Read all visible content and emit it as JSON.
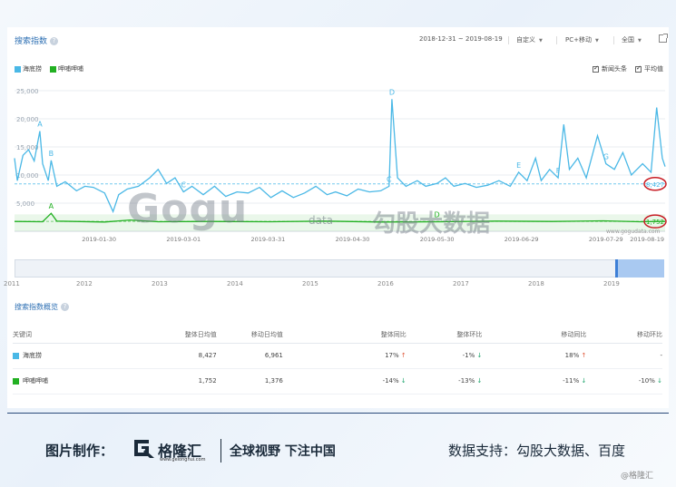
{
  "header": {
    "title": "搜索指数",
    "date_range": "2018-12-31 ~ 2019-08-19",
    "custom": "自定义",
    "device": "PC+移动",
    "region": "全国"
  },
  "legend": {
    "series1": "海底捞",
    "series2": "呷哺呷哺",
    "opt1": "新闻头条",
    "opt2": "平均值"
  },
  "colors": {
    "series1": "#4ab8e6",
    "series2": "#22b022",
    "avg1": "#74c9ee",
    "avg2": "#c2e8c2",
    "highlight": "#c81d25"
  },
  "chart_data": {
    "type": "line",
    "ylim": [
      0,
      25000
    ],
    "yticks": [
      "5,000",
      "10,000",
      "15,000",
      "20,000",
      "25,000"
    ],
    "xticks": [
      "2019-01-30",
      "2019-03-01",
      "2019-03-31",
      "2019-04-30",
      "2019-05-30",
      "2019-06-29",
      "2019-07-29",
      "2019-08-19"
    ],
    "x_start": "2018-12-31",
    "x_end": "2019-08-19",
    "series": [
      {
        "name": "海底捞",
        "points": [
          [
            "2018-12-31",
            13000
          ],
          [
            "2019-01-01",
            9000
          ],
          [
            "2019-01-03",
            13500
          ],
          [
            "2019-01-05",
            14500
          ],
          [
            "2019-01-07",
            12500
          ],
          [
            "2019-01-09",
            17800
          ],
          [
            "2019-01-10",
            12000
          ],
          [
            "2019-01-12",
            9000
          ],
          [
            "2019-01-13",
            12600
          ],
          [
            "2019-01-15",
            8000
          ],
          [
            "2019-01-18",
            8800
          ],
          [
            "2019-01-22",
            7200
          ],
          [
            "2019-01-25",
            8000
          ],
          [
            "2019-01-28",
            7800
          ],
          [
            "2019-02-01",
            6800
          ],
          [
            "2019-02-04",
            3500
          ],
          [
            "2019-02-06",
            6500
          ],
          [
            "2019-02-09",
            7500
          ],
          [
            "2019-02-13",
            8000
          ],
          [
            "2019-02-17",
            9500
          ],
          [
            "2019-02-20",
            11000
          ],
          [
            "2019-02-23",
            8500
          ],
          [
            "2019-02-26",
            9500
          ],
          [
            "2019-03-01",
            7000
          ],
          [
            "2019-03-04",
            8000
          ],
          [
            "2019-03-08",
            6500
          ],
          [
            "2019-03-12",
            8000
          ],
          [
            "2019-03-16",
            6200
          ],
          [
            "2019-03-20",
            7000
          ],
          [
            "2019-03-24",
            6800
          ],
          [
            "2019-03-28",
            7800
          ],
          [
            "2019-04-01",
            6000
          ],
          [
            "2019-04-05",
            7200
          ],
          [
            "2019-04-09",
            6000
          ],
          [
            "2019-04-13",
            6800
          ],
          [
            "2019-04-17",
            8000
          ],
          [
            "2019-04-21",
            6500
          ],
          [
            "2019-04-24",
            7000
          ],
          [
            "2019-04-28",
            6300
          ],
          [
            "2019-05-02",
            7500
          ],
          [
            "2019-05-06",
            7000
          ],
          [
            "2019-05-10",
            7200
          ],
          [
            "2019-05-13",
            8000
          ],
          [
            "2019-05-14",
            23500
          ],
          [
            "2019-05-16",
            9500
          ],
          [
            "2019-05-19",
            8000
          ],
          [
            "2019-05-23",
            9000
          ],
          [
            "2019-05-26",
            8000
          ],
          [
            "2019-05-30",
            8500
          ],
          [
            "2019-06-02",
            9500
          ],
          [
            "2019-06-05",
            8000
          ],
          [
            "2019-06-09",
            8500
          ],
          [
            "2019-06-13",
            7800
          ],
          [
            "2019-06-17",
            8200
          ],
          [
            "2019-06-21",
            9000
          ],
          [
            "2019-06-25",
            8000
          ],
          [
            "2019-06-28",
            10500
          ],
          [
            "2019-07-01",
            9000
          ],
          [
            "2019-07-04",
            13000
          ],
          [
            "2019-07-06",
            9000
          ],
          [
            "2019-07-09",
            11000
          ],
          [
            "2019-07-12",
            9500
          ],
          [
            "2019-07-14",
            19000
          ],
          [
            "2019-07-16",
            11000
          ],
          [
            "2019-07-19",
            13000
          ],
          [
            "2019-07-22",
            9500
          ],
          [
            "2019-07-26",
            17000
          ],
          [
            "2019-07-29",
            12000
          ],
          [
            "2019-08-01",
            11000
          ],
          [
            "2019-08-04",
            14000
          ],
          [
            "2019-08-07",
            10000
          ],
          [
            "2019-08-11",
            12000
          ],
          [
            "2019-08-14",
            10500
          ],
          [
            "2019-08-16",
            22000
          ],
          [
            "2019-08-18",
            13000
          ],
          [
            "2019-08-19",
            11500
          ]
        ]
      },
      {
        "name": "呷哺呷哺",
        "points": [
          [
            "2018-12-31",
            1750
          ],
          [
            "2019-01-10",
            1700
          ],
          [
            "2019-01-13",
            3200
          ],
          [
            "2019-01-15",
            1800
          ],
          [
            "2019-02-01",
            1650
          ],
          [
            "2019-02-10",
            2000
          ],
          [
            "2019-02-20",
            1700
          ],
          [
            "2019-03-10",
            1750
          ],
          [
            "2019-04-01",
            1700
          ],
          [
            "2019-04-20",
            1800
          ],
          [
            "2019-05-10",
            1650
          ],
          [
            "2019-06-01",
            1700
          ],
          [
            "2019-06-20",
            1800
          ],
          [
            "2019-07-10",
            1750
          ],
          [
            "2019-07-28",
            1850
          ],
          [
            "2019-08-10",
            1700
          ],
          [
            "2019-08-19",
            1750
          ]
        ]
      }
    ],
    "averages": {
      "海底捞": "8,427",
      "呷哺呷哺": "1,752"
    },
    "avg_values": [
      8427,
      1752
    ],
    "annotations": [
      {
        "label": "A",
        "date": "2019-01-09",
        "series": "海底捞"
      },
      {
        "label": "B",
        "date": "2019-01-13",
        "series": "海底捞"
      },
      {
        "label": "A",
        "date": "2019-01-13",
        "series": "呷哺呷哺"
      },
      {
        "label": "C",
        "date": "2019-03-01",
        "series": "海底捞"
      },
      {
        "label": "C",
        "date": "2019-05-13",
        "series": "海底捞"
      },
      {
        "label": "D",
        "date": "2019-05-14",
        "series": "海底捞"
      },
      {
        "label": "D",
        "date": "2019-05-30",
        "series": "呷哺呷哺"
      },
      {
        "label": "E",
        "date": "2019-06-28",
        "series": "海底捞"
      },
      {
        "label": "F",
        "date": "2019-07-12",
        "series": "海底捞"
      },
      {
        "label": "G",
        "date": "2019-07-29",
        "series": "海底捞"
      }
    ]
  },
  "navigator_years": [
    "2011",
    "2012",
    "2013",
    "2014",
    "2015",
    "2016",
    "2017",
    "2018",
    "2019"
  ],
  "overview": {
    "title": "搜索指数概览",
    "headers": [
      "关键词",
      "整体日均值",
      "移动日均值",
      "整体同比",
      "整体环比",
      "移动同比",
      "移动环比"
    ],
    "rows": [
      {
        "keyword": "海底捞",
        "overall": "8,427",
        "mobile": "6,961",
        "yoy": "17%",
        "yoy_dir": "up",
        "mom": "-1%",
        "mom_dir": "down",
        "m_yoy": "18%",
        "m_yoy_dir": "up",
        "m_mom": "-",
        "m_mom_dir": ""
      },
      {
        "keyword": "呷哺呷哺",
        "overall": "1,752",
        "mobile": "1,376",
        "yoy": "-14%",
        "yoy_dir": "down",
        "mom": "-13%",
        "mom_dir": "down",
        "m_yoy": "-11%",
        "m_yoy_dir": "down",
        "m_mom": "-10%",
        "m_mom_dir": "down"
      }
    ]
  },
  "watermark": {
    "logo": "Gogu",
    "sub": "data",
    "cn": "勾股大数据",
    "url": "www.gogudata.com"
  },
  "footer": {
    "made_by": "图片制作：",
    "brand": "格隆汇",
    "brand_url": "www.gelonghui.com",
    "slogan": "全球视野 下注中国",
    "source": "数据支持：勾股大数据、百度",
    "credit": "@格隆汇"
  }
}
